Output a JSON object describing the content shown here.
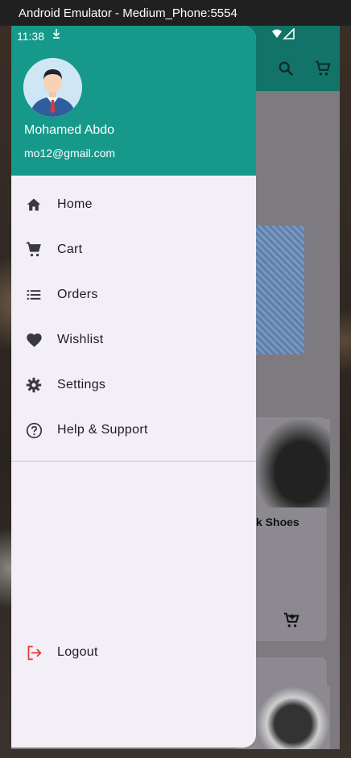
{
  "window": {
    "title": "Android Emulator - Medium_Phone:5554"
  },
  "status_bar": {
    "time": "11:38"
  },
  "drawer": {
    "user": {
      "name": "Mohamed Abdo",
      "email": "mo12@gmail.com"
    },
    "items": [
      {
        "label": "Home",
        "icon": "home-icon"
      },
      {
        "label": "Cart",
        "icon": "cart-icon"
      },
      {
        "label": "Orders",
        "icon": "list-icon"
      },
      {
        "label": "Wishlist",
        "icon": "heart-icon"
      },
      {
        "label": "Settings",
        "icon": "gear-icon"
      },
      {
        "label": "Help & Support",
        "icon": "help-icon"
      }
    ],
    "logout": {
      "label": "Logout",
      "icon": "logout-icon"
    }
  },
  "background_page": {
    "product_label": "k Shoes"
  },
  "colors": {
    "header": "#16998a",
    "drawer_bg": "#f3eff7",
    "logout_icon": "#e53935"
  }
}
